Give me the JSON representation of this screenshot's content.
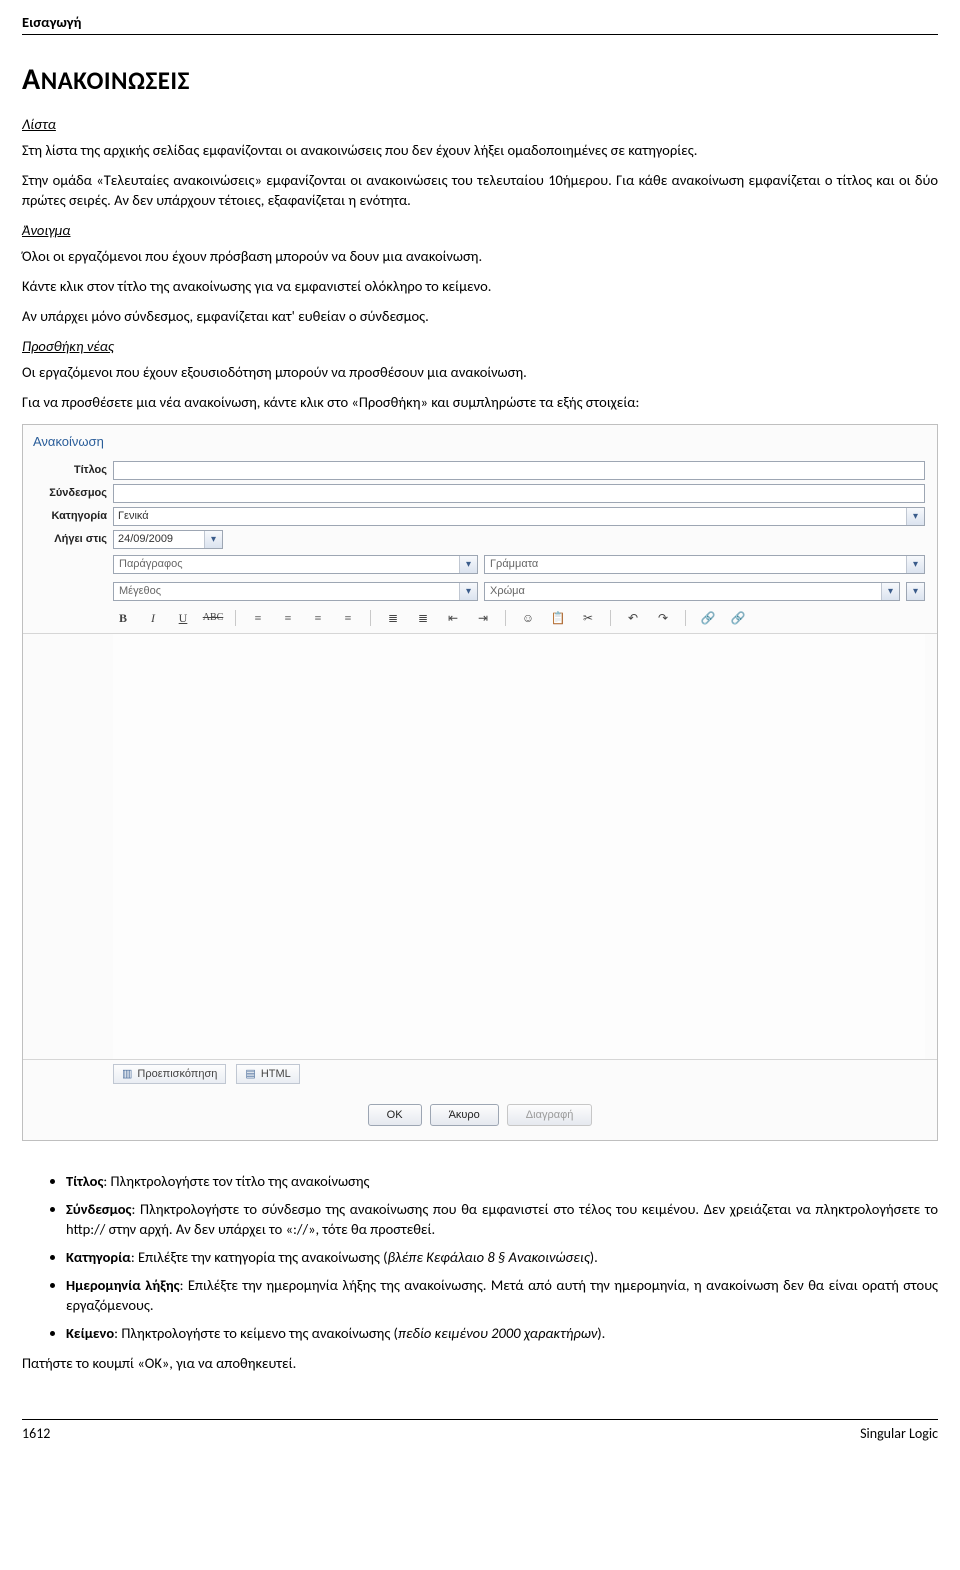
{
  "header": "Εισαγωγή",
  "section_title_drop": "Α",
  "section_title_rest": "ΝΑΚΟΙΝΩΣΕΙΣ",
  "s1": {
    "title": "Λίστα",
    "p1": "Στη λίστα της αρχικής σελίδας εμφανίζονται οι ανακοινώσεις που δεν έχουν λήξει ομαδοποιημένες σε κατηγορίες.",
    "p2": "Στην ομάδα «Τελευταίες ανακοινώσεις» εμφανίζονται οι ανακοινώσεις του τελευταίου 10ήμερου. Για κάθε ανακοίνωση εμφανίζεται ο τίτλος και οι δύο πρώτες σειρές. Αν δεν υπάρχουν τέτοιες, εξαφανίζεται η ενότητα."
  },
  "s2": {
    "title": "Άνοιγμα",
    "p1": "Όλοι οι εργαζόμενοι που έχουν πρόσβαση μπορούν να δουν μια ανακοίνωση.",
    "p2": "Κάντε κλικ στον τίτλο της ανακοίνωσης για να εμφανιστεί ολόκληρο το κείμενο.",
    "p3": "Αν υπάρχει μόνο σύνδεσμος, εμφανίζεται κατ' ευθείαν ο σύνδεσμος."
  },
  "s3": {
    "title": "Προσθήκη νέας",
    "p1": "Οι εργαζόμενοι που έχουν εξουσιοδότηση μπορούν να προσθέσουν μια ανακοίνωση.",
    "p2": "Για να προσθέσετε μια νέα ανακοίνωση, κάντε κλικ στο «Προσθήκη» και συμπληρώστε τα εξής στοιχεία:"
  },
  "form": {
    "panel_title": "Ανακοίνωση",
    "labels": {
      "title": "Τίτλος",
      "link": "Σύνδεσμος",
      "category": "Κατηγορία",
      "expires": "Λήγει στις"
    },
    "category_value": "Γενικά",
    "date_value": "24/09/2009",
    "editor": {
      "paragraph_label": "Παράγραφος",
      "font_label": "Γράμματα",
      "size_label": "Μέγεθος",
      "color_label": "Χρώμα",
      "preview_tab": "Προεπισκόπηση",
      "html_tab": "HTML"
    },
    "buttons": {
      "ok": "OK",
      "cancel": "Άκυρο",
      "delete": "Διαγραφή"
    }
  },
  "bullets": {
    "b1a": "Τίτλος",
    "b1b": ": Πληκτρολογήστε τον τίτλο της ανακοίνωσης",
    "b2a": "Σύνδεσμος",
    "b2b": ": Πληκτρολογήστε το σύνδεσμο της ανακοίνωσης που θα εμφανιστεί στο τέλος του κειμένου. Δεν χρειάζεται να πληκτρολογήσετε το http:// στην αρχή. Αν δεν υπάρχει το «://», τότε θα προστεθεί.",
    "b3a": "Κατηγορία",
    "b3b": ": Επιλέξτε την κατηγορία της ανακοίνωσης (",
    "b3c": "βλέπε Κεφάλαιο 8 § Ανακοινώσεις",
    "b3d": ").",
    "b4a": "Ημερομηνία λήξης",
    "b4b": ": Επιλέξτε την ημερομηνία λήξης της ανακοίνωσης. Μετά από αυτή την ημερομηνία, η ανακοίνωση δεν θα είναι ορατή στους εργαζόμενους.",
    "b5a": "Κείμενο",
    "b5b": ": Πληκτρολογήστε το κείμενο της ανακοίνωσης (",
    "b5c": "πεδίο κειμένου 2000 χαρακτήρων",
    "b5d": ")."
  },
  "closing": "Πατήστε το κουμπί «ΟΚ», για να αποθηκευτεί.",
  "footer": {
    "left": "1612",
    "right": "Singular Logic"
  }
}
